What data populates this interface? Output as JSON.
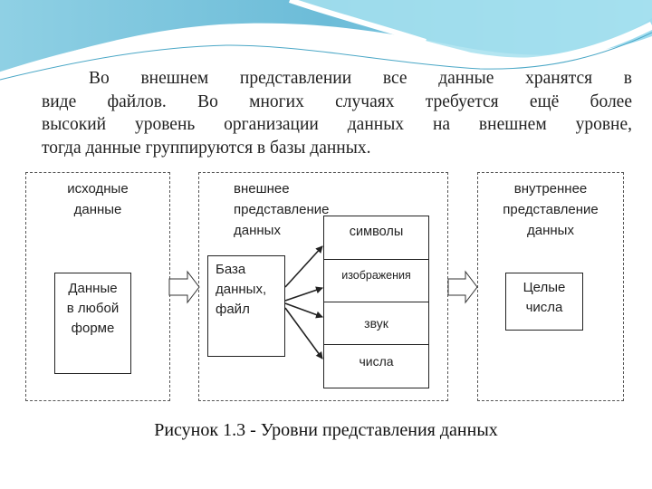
{
  "paragraph": {
    "lines": [
      "Во внешнем представлении все данные хранятся в",
      "виде файлов. Во многих случаях требуется ещё более",
      "высокий уровень организации данных на внешнем уровне,",
      "тогда данные группируются в базы данных."
    ]
  },
  "diagram": {
    "source": {
      "title_lines": [
        "исходные",
        "данные"
      ],
      "box_lines": [
        "Данные",
        "в любой",
        "форме"
      ]
    },
    "external": {
      "title_lines": [
        "внешнее",
        "представление",
        "данных"
      ],
      "box_lines": [
        "База",
        "данных,",
        "файл"
      ],
      "types": [
        "символы",
        "изображения",
        "звук",
        "числа"
      ]
    },
    "internal": {
      "title_lines": [
        "внутреннее",
        "представление",
        "данных"
      ],
      "box_lines": [
        "Целые",
        "числа"
      ]
    }
  },
  "caption": "Рисунок 1.3 - Уровни представления данных",
  "colors": {
    "wave_dark": "#5fb6d2",
    "wave_light": "#a9dff0",
    "line": "#222222"
  }
}
